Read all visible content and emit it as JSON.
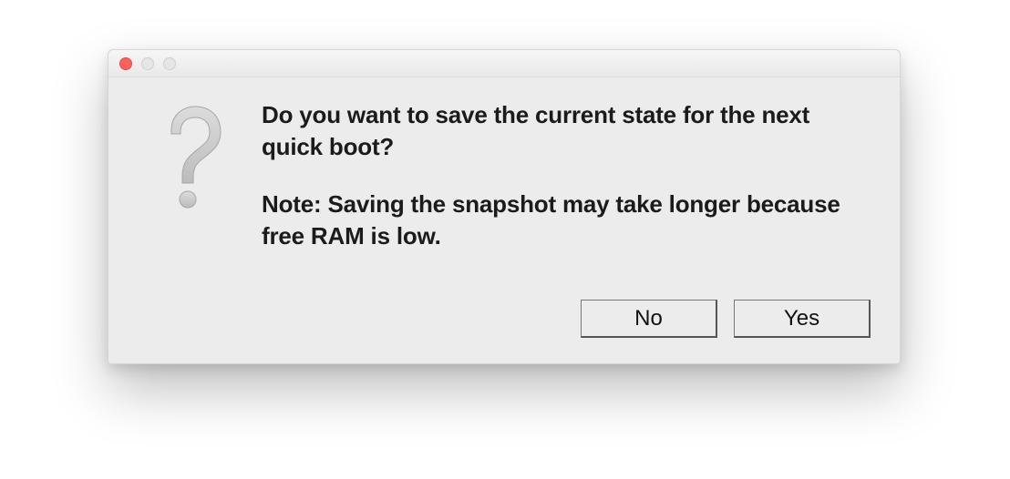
{
  "dialog": {
    "message_main": "Do you want to save the current state for the next quick boot?",
    "message_note": "Note: Saving the snapshot may take longer because free RAM is low.",
    "buttons": {
      "no": "No",
      "yes": "Yes"
    },
    "icon": "question-mark"
  },
  "colors": {
    "window_bg": "#ececec",
    "traffic_close": "#ff5f57",
    "icon_fill": "#cfcfcf",
    "icon_edge": "#a9a9a9"
  }
}
